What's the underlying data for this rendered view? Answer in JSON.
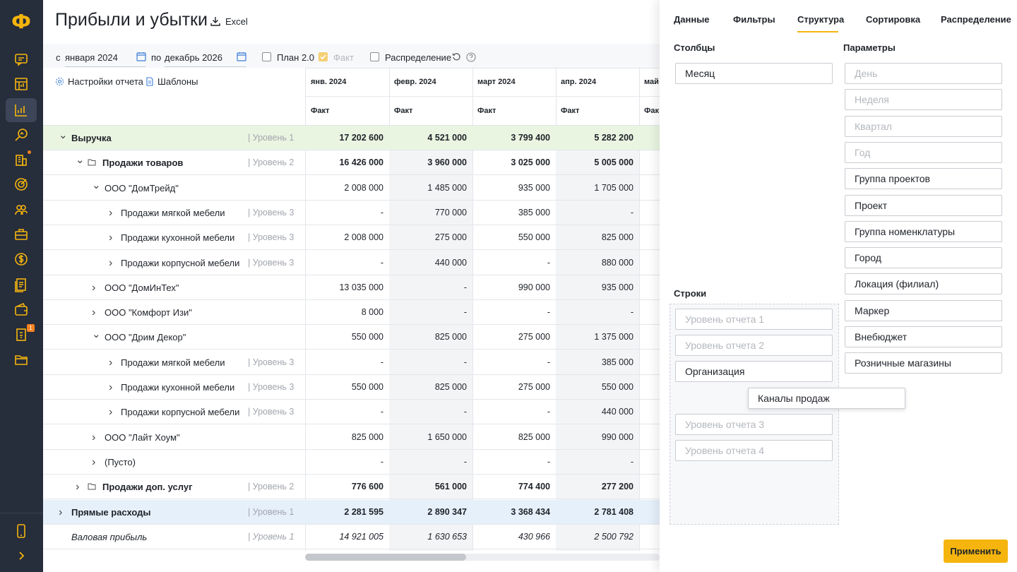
{
  "app": {
    "logo": "Ф",
    "title": "Прибыли и убытки",
    "excel_label": "Excel"
  },
  "sidebar": {
    "items": [
      "chat-icon",
      "dashboard-icon",
      "chart-icon",
      "analytics-icon",
      "buildings-icon",
      "target-icon",
      "users-icon",
      "briefcase-icon",
      "dollar-icon",
      "documents-icon",
      "wallet-icon",
      "invoice-icon",
      "folder-icon"
    ],
    "active": "chart-icon",
    "badge": "1",
    "bottom": [
      "mobile-icon",
      "expand-icon"
    ],
    "accent": "#f5b50e",
    "badge_color": "#f58220"
  },
  "filters": {
    "from_label": "с",
    "from_value": "января 2024",
    "to_label": "по",
    "to_value": "декабрь 2026",
    "plan_label": "План 2.0",
    "fact_label": "Факт",
    "distribution_label": "Распределение"
  },
  "settings": {
    "report_settings": "Настройки отчета",
    "templates": "Шаблоны"
  },
  "columns": [
    {
      "month": "янв. 2024",
      "sub": "Факт"
    },
    {
      "month": "февр. 2024",
      "sub": "Факт"
    },
    {
      "month": "март 2024",
      "sub": "Факт"
    },
    {
      "month": "апр. 2024",
      "sub": "Факт"
    },
    {
      "month": "май",
      "sub": "Фак"
    }
  ],
  "rows": [
    {
      "name": "Выручка",
      "level": "| Уровень 1",
      "values": [
        "17 202 600",
        "4 521 000",
        "3 799 400",
        "5 282 200"
      ],
      "chevron": "v"
    },
    {
      "name": "Продажи товаров",
      "level": "| Уровень 2",
      "values": [
        "16 426 000",
        "3 960 000",
        "3 025 000",
        "5 005 000"
      ],
      "chevron": "v"
    },
    {
      "name": "ООО \"ДомТрейд\"",
      "level": "",
      "values": [
        "2 008 000",
        "1 485 000",
        "935 000",
        "1 705 000"
      ],
      "chevron": "v"
    },
    {
      "name": "Продажи мягкой мебели",
      "level": "| Уровень 3",
      "values": [
        "-",
        "770 000",
        "385 000",
        "-"
      ],
      "chevron": ">"
    },
    {
      "name": "Продажи кухонной мебели",
      "level": "| Уровень 3",
      "values": [
        "2 008 000",
        "275 000",
        "550 000",
        "825 000"
      ],
      "chevron": ">"
    },
    {
      "name": "Продажи корпусной мебели",
      "level": "| Уровень 3",
      "values": [
        "-",
        "440 000",
        "-",
        "880 000"
      ],
      "chevron": ">"
    },
    {
      "name": "ООО \"ДомИнТех\"",
      "level": "",
      "values": [
        "13 035 000",
        "-",
        "990 000",
        "935 000"
      ],
      "chevron": ">"
    },
    {
      "name": "ООО \"Комфорт Изи\"",
      "level": "",
      "values": [
        "8 000",
        "-",
        "-",
        "-"
      ],
      "chevron": ">"
    },
    {
      "name": "ООО \"Дрим Декор\"",
      "level": "",
      "values": [
        "550 000",
        "825 000",
        "275 000",
        "1 375 000"
      ],
      "chevron": "v"
    },
    {
      "name": "Продажи мягкой мебели",
      "level": "| Уровень 3",
      "values": [
        "-",
        "-",
        "-",
        "385 000"
      ],
      "chevron": ">"
    },
    {
      "name": "Продажи кухонной мебели",
      "level": "| Уровень 3",
      "values": [
        "550 000",
        "825 000",
        "275 000",
        "550 000"
      ],
      "chevron": ">"
    },
    {
      "name": "Продажи корпусной мебели",
      "level": "| Уровень 3",
      "values": [
        "-",
        "-",
        "-",
        "440 000"
      ],
      "chevron": ">"
    },
    {
      "name": "ООО \"Лайт Хоум\"",
      "level": "",
      "values": [
        "825 000",
        "1 650 000",
        "825 000",
        "990 000"
      ],
      "chevron": ">"
    },
    {
      "name": "(Пусто)",
      "level": "",
      "values": [
        "-",
        "-",
        "-",
        "-"
      ],
      "chevron": ">"
    },
    {
      "name": "Продажи доп. услуг",
      "level": "| Уровень 2",
      "values": [
        "776 600",
        "561 000",
        "774 400",
        "277 200"
      ],
      "chevron": ">"
    },
    {
      "name": "Прямые расходы",
      "level": "| Уровень 1",
      "values": [
        "2 281 595",
        "2 890 347",
        "3 368 434",
        "2 781 408"
      ],
      "chevron": ">"
    },
    {
      "name": "Валовая прибыль",
      "level": "| Уровень 1",
      "values": [
        "14 921 005",
        "1 630 653",
        "430 966",
        "2 500 792"
      ],
      "chevron": ""
    }
  ],
  "colors": {
    "revenue_row": "#e9f5e1",
    "expense_row": "#e6f0fb"
  },
  "panel": {
    "tabs": [
      "Данные",
      "Фильтры",
      "Структура",
      "Сортировка",
      "Распределение"
    ],
    "active_tab": "Структура",
    "columns_title": "Столбцы",
    "params_title": "Параметры",
    "rows_title": "Строки",
    "columns_box": "Месяц",
    "params": [
      "День",
      "Неделя",
      "Квартал",
      "Год",
      "Группа проектов",
      "Проект",
      "Группа номенклатуры",
      "Город",
      "Локация (филиал)",
      "Маркер",
      "Внебюджет",
      "Розничные магазины"
    ],
    "rows_boxes": [
      "Уровень отчета 1",
      "Уровень отчета 2",
      "Организация",
      "Уровень отчета 3",
      "Уровень отчета 4"
    ],
    "dragging": "Каналы продаж",
    "apply": "Применить"
  }
}
